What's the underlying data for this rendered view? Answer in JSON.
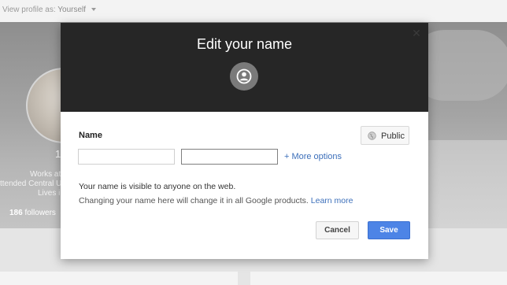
{
  "background": {
    "view_profile_label": "View profile as:",
    "view_profile_value": "Yourself",
    "works_text": "Works at",
    "attended_text": "ttended Central U",
    "lives_text": "Lives i",
    "name_fragment": "1",
    "followers_count": "186",
    "followers_label": "followers"
  },
  "modal": {
    "title": "Edit your name",
    "header_icon": "profile-circle-icon",
    "close_icon": "close-icon",
    "name_label": "Name",
    "visibility_button": "Public",
    "visibility_icon": "globe-icon",
    "first_name_value": "",
    "last_name_value": "",
    "more_options_plus": "+",
    "more_options_label": "More options",
    "visible_note": "Your name is visible to anyone on the web.",
    "change_note": "Changing your name here will change it in all Google products.",
    "learn_more": "Learn more",
    "cancel_label": "Cancel",
    "save_label": "Save"
  },
  "colors": {
    "header_bg": "#262626",
    "accent_blue": "#4d84e6",
    "link_blue": "#3c6fba"
  }
}
